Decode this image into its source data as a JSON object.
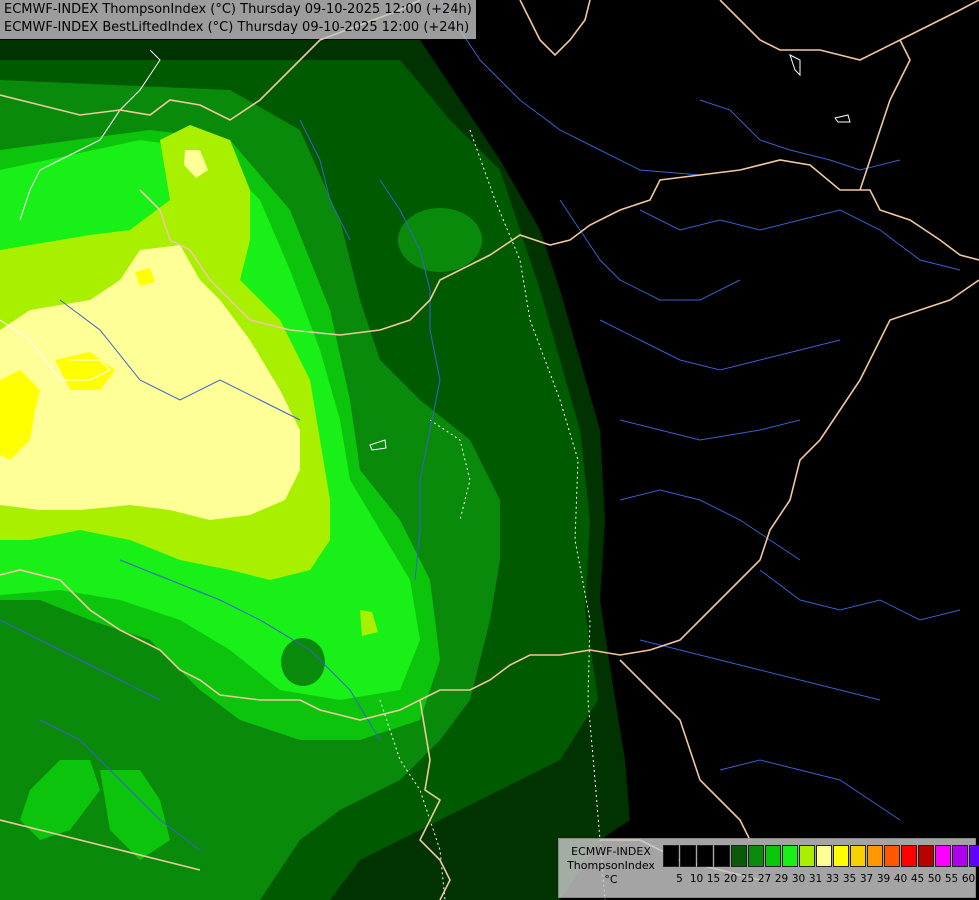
{
  "title": {
    "line1": "ECMWF-INDEX ThompsonIndex (°C) Thursday 09-10-2025 12:00 (+24h)",
    "line2": "ECMWF-INDEX BestLiftedIndex (°C) Thursday 09-10-2025 12:00 (+24h)"
  },
  "legend": {
    "line1": "ECMWF-INDEX",
    "line2": "ThompsonIndex",
    "unit": "°C",
    "colors": [
      "#000000",
      "#000000",
      "#000000",
      "#000000",
      "#0a5a0a",
      "#0a8a0a",
      "#0cc40c",
      "#18f018",
      "#a8f000",
      "#ffff98",
      "#ffff00",
      "#f8d000",
      "#ff9800",
      "#ff5800",
      "#ff0000",
      "#b80000",
      "#ff00ff",
      "#b000f0",
      "#6000ff",
      "#0000ff"
    ],
    "ticks": [
      "5",
      "10",
      "15",
      "20",
      "25",
      "27",
      "29",
      "30",
      "31",
      "33",
      "35",
      "37",
      "39",
      "40",
      "45",
      "50",
      "55",
      "60"
    ]
  },
  "colors": {
    "darkest_green": "#003300",
    "dark_green": "#005a00",
    "green": "#0a8a0a",
    "bright_green": "#0cc40c",
    "lime": "#18f018",
    "yellow_green": "#a8f000",
    "pale_yellow": "#ffff98",
    "yellow": "#ffff00",
    "border": "#f0c8a0",
    "river": "#3a5fd0"
  }
}
